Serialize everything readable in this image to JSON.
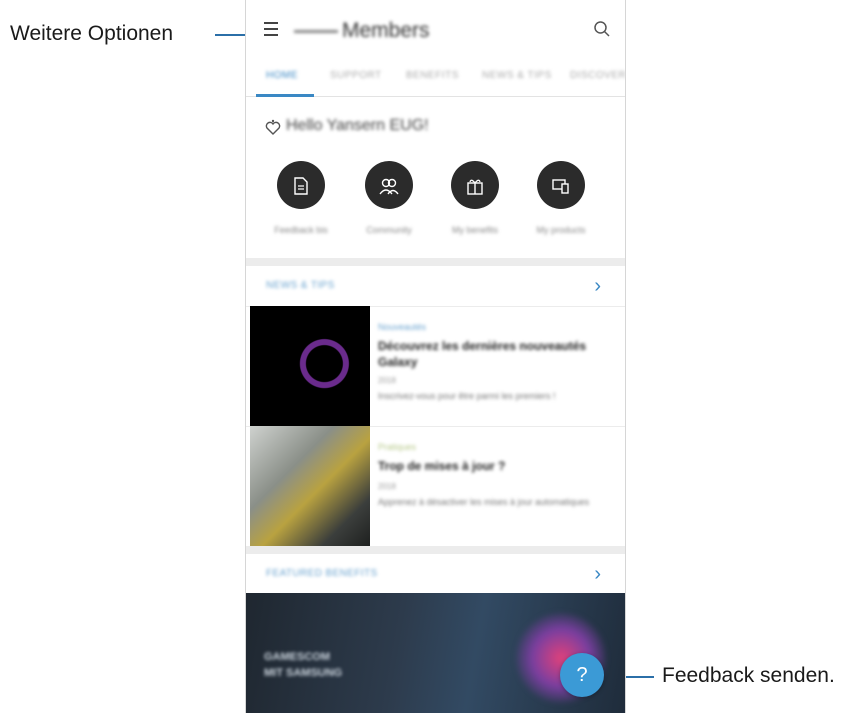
{
  "callouts": {
    "more_options": "Weitere Optionen",
    "feedback": "Feedback senden."
  },
  "appbar": {
    "title": "Members",
    "menu_icon": "menu-icon",
    "search_icon": "search-icon"
  },
  "tabs": [
    {
      "label": "HOME",
      "active": true
    },
    {
      "label": "SUPPORT",
      "active": false
    },
    {
      "label": "BENEFITS",
      "active": false
    },
    {
      "label": "NEWS & TIPS",
      "active": false
    },
    {
      "label": "DISCOVER",
      "active": false
    }
  ],
  "greeting": {
    "text": "Hello Yansern EUG!",
    "icon": "heart-hand-icon"
  },
  "shortcuts": [
    {
      "label": "Feedback bis",
      "icon": "document-icon"
    },
    {
      "label": "Community",
      "icon": "people-icon"
    },
    {
      "label": "My benefits",
      "icon": "gift-icon"
    },
    {
      "label": "My products",
      "icon": "devices-icon"
    }
  ],
  "news_section": {
    "title": "NEWS & TIPS",
    "chevron_icon": "chevron-right-icon"
  },
  "articles": [
    {
      "category": "Nouveautés",
      "category_color": "#6aa3cf",
      "title": "Découvrez les dernières nouveautés Galaxy",
      "date": "2018",
      "desc": "Inscrivez-vous pour être parmi les premiers !"
    },
    {
      "category": "Pratiques",
      "category_color": "#b7c98a",
      "title": "Trop de mises à jour ?",
      "date": "2018",
      "desc": "Apprenez à désactiver les mises à jour automatiques"
    }
  ],
  "featured_section": {
    "title": "FEATURED BENEFITS",
    "chevron_icon": "chevron-right-icon"
  },
  "banner": {
    "line1": "GAMESCOM",
    "line2": "MIT SAMSUNG"
  },
  "fab": {
    "label": "?",
    "icon": "help-icon",
    "color": "#3b9ad6"
  },
  "colors": {
    "accent": "#3a88c4",
    "callout_line": "#2b6fa8"
  }
}
